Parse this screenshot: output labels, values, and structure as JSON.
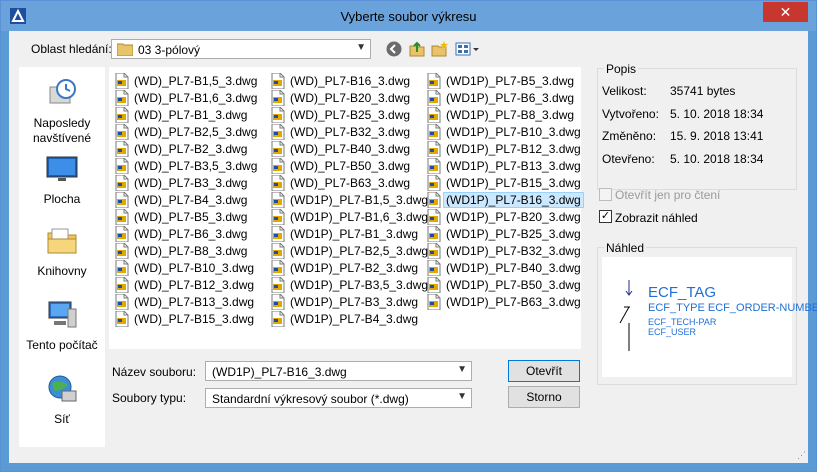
{
  "window": {
    "title": "Vyberte soubor výkresu",
    "close_label": "✕"
  },
  "lookin": {
    "label": "Oblast hledání:",
    "value": "03 3-pólový"
  },
  "places": [
    {
      "label": "Naposledy navštívené",
      "icon": "recent-places-icon"
    },
    {
      "label": "Plocha",
      "icon": "desktop-icon"
    },
    {
      "label": "Knihovny",
      "icon": "libraries-icon"
    },
    {
      "label": "Tento počítač",
      "icon": "computer-icon"
    },
    {
      "label": "Síť",
      "icon": "network-icon"
    }
  ],
  "files": {
    "column1": [
      "(WD)_PL7-B1,5_3.dwg",
      "(WD)_PL7-B1,6_3.dwg",
      "(WD)_PL7-B1_3.dwg",
      "(WD)_PL7-B2,5_3.dwg",
      "(WD)_PL7-B2_3.dwg",
      "(WD)_PL7-B3,5_3.dwg",
      "(WD)_PL7-B3_3.dwg",
      "(WD)_PL7-B4_3.dwg",
      "(WD)_PL7-B5_3.dwg",
      "(WD)_PL7-B6_3.dwg",
      "(WD)_PL7-B8_3.dwg",
      "(WD)_PL7-B10_3.dwg",
      "(WD)_PL7-B12_3.dwg",
      "(WD)_PL7-B13_3.dwg",
      "(WD)_PL7-B15_3.dwg"
    ],
    "column2": [
      "(WD)_PL7-B16_3.dwg",
      "(WD)_PL7-B20_3.dwg",
      "(WD)_PL7-B25_3.dwg",
      "(WD)_PL7-B32_3.dwg",
      "(WD)_PL7-B40_3.dwg",
      "(WD)_PL7-B50_3.dwg",
      "(WD)_PL7-B63_3.dwg",
      "(WD1P)_PL7-B1,5_3.dwg",
      "(WD1P)_PL7-B1,6_3.dwg",
      "(WD1P)_PL7-B1_3.dwg",
      "(WD1P)_PL7-B2,5_3.dwg",
      "(WD1P)_PL7-B2_3.dwg",
      "(WD1P)_PL7-B3,5_3.dwg",
      "(WD1P)_PL7-B3_3.dwg",
      "(WD1P)_PL7-B4_3.dwg"
    ],
    "column3": [
      "(WD1P)_PL7-B5_3.dwg",
      "(WD1P)_PL7-B6_3.dwg",
      "(WD1P)_PL7-B8_3.dwg",
      "(WD1P)_PL7-B10_3.dwg",
      "(WD1P)_PL7-B12_3.dwg",
      "(WD1P)_PL7-B13_3.dwg",
      "(WD1P)_PL7-B15_3.dwg",
      "(WD1P)_PL7-B16_3.dwg",
      "(WD1P)_PL7-B20_3.dwg",
      "(WD1P)_PL7-B25_3.dwg",
      "(WD1P)_PL7-B32_3.dwg",
      "(WD1P)_PL7-B40_3.dwg",
      "(WD1P)_PL7-B50_3.dwg",
      "(WD1P)_PL7-B63_3.dwg"
    ],
    "selected": "(WD1P)_PL7-B16_3.dwg"
  },
  "filename": {
    "label": "Název souboru:",
    "value": "(WD1P)_PL7-B16_3.dwg"
  },
  "filetype": {
    "label": "Soubory typu:",
    "value": "Standardní výkresový soubor (*.dwg)"
  },
  "buttons": {
    "open": "Otevřít",
    "cancel": "Storno"
  },
  "description": {
    "title": "Popis",
    "size_label": "Velikost:",
    "size_value": "35741 bytes",
    "created_label": "Vytvořeno:",
    "created_value": "5. 10. 2018 18:34",
    "modified_label": "Změněno:",
    "modified_value": "15. 9. 2018 13:41",
    "opened_label": "Otevřeno:",
    "opened_value": "5. 10. 2018 18:34"
  },
  "options": {
    "readonly_label": "Otevřít jen pro čtení",
    "readonly_checked": false,
    "preview_label": "Zobrazit náhled",
    "preview_checked": true
  },
  "preview": {
    "title": "Náhled",
    "tag": "ECF_TAG",
    "line2": "ECF_TYPE ECF_ORDER-NUMBER",
    "line3": "ECF_TECH-PAR",
    "line4": "ECF_USER"
  },
  "colors": {
    "titlebar": "#6aa3dc",
    "selection": "#cce8ff",
    "preview_text": "#1f6fd6"
  }
}
